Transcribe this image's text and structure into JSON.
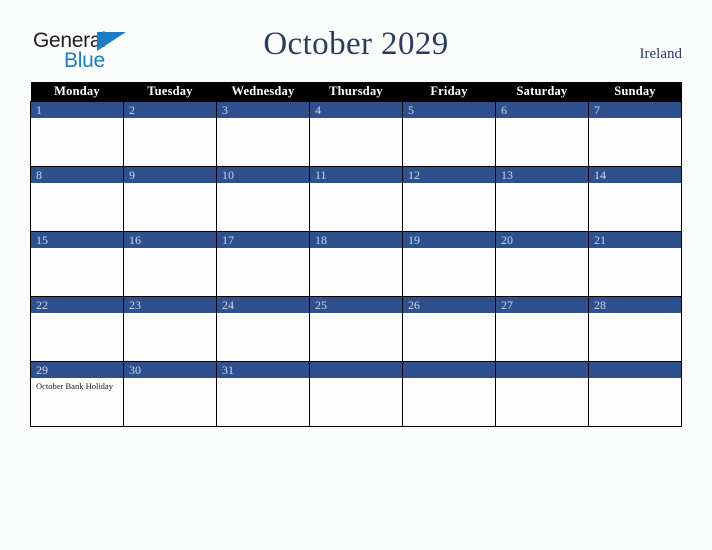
{
  "brand": {
    "name_top": "General",
    "name_bottom": "Blue",
    "triangle_color": "#1a7ec4"
  },
  "header": {
    "title": "October 2029",
    "region": "Ireland"
  },
  "calendar": {
    "month": "October",
    "year": "2029",
    "colors": {
      "header_band": "#000000",
      "date_band": "#2e508f",
      "date_text": "#cdd6e6",
      "title_text": "#2b3c63",
      "grid_line": "#000000",
      "cell_background": "#fdfdfd",
      "page_background": "#fbfcfc"
    },
    "weekday_headers": [
      "Monday",
      "Tuesday",
      "Wednesday",
      "Thursday",
      "Friday",
      "Saturday",
      "Sunday"
    ],
    "weeks": [
      [
        {
          "date": "1",
          "events": []
        },
        {
          "date": "2",
          "events": []
        },
        {
          "date": "3",
          "events": []
        },
        {
          "date": "4",
          "events": []
        },
        {
          "date": "5",
          "events": []
        },
        {
          "date": "6",
          "events": []
        },
        {
          "date": "7",
          "events": []
        }
      ],
      [
        {
          "date": "8",
          "events": []
        },
        {
          "date": "9",
          "events": []
        },
        {
          "date": "10",
          "events": []
        },
        {
          "date": "11",
          "events": []
        },
        {
          "date": "12",
          "events": []
        },
        {
          "date": "13",
          "events": []
        },
        {
          "date": "14",
          "events": []
        }
      ],
      [
        {
          "date": "15",
          "events": []
        },
        {
          "date": "16",
          "events": []
        },
        {
          "date": "17",
          "events": []
        },
        {
          "date": "18",
          "events": []
        },
        {
          "date": "19",
          "events": []
        },
        {
          "date": "20",
          "events": []
        },
        {
          "date": "21",
          "events": []
        }
      ],
      [
        {
          "date": "22",
          "events": []
        },
        {
          "date": "23",
          "events": []
        },
        {
          "date": "24",
          "events": []
        },
        {
          "date": "25",
          "events": []
        },
        {
          "date": "26",
          "events": []
        },
        {
          "date": "27",
          "events": []
        },
        {
          "date": "28",
          "events": []
        }
      ],
      [
        {
          "date": "29",
          "events": [
            "October Bank Holiday"
          ]
        },
        {
          "date": "30",
          "events": []
        },
        {
          "date": "31",
          "events": []
        },
        {
          "date": "",
          "events": []
        },
        {
          "date": "",
          "events": []
        },
        {
          "date": "",
          "events": []
        },
        {
          "date": "",
          "events": []
        }
      ]
    ]
  }
}
